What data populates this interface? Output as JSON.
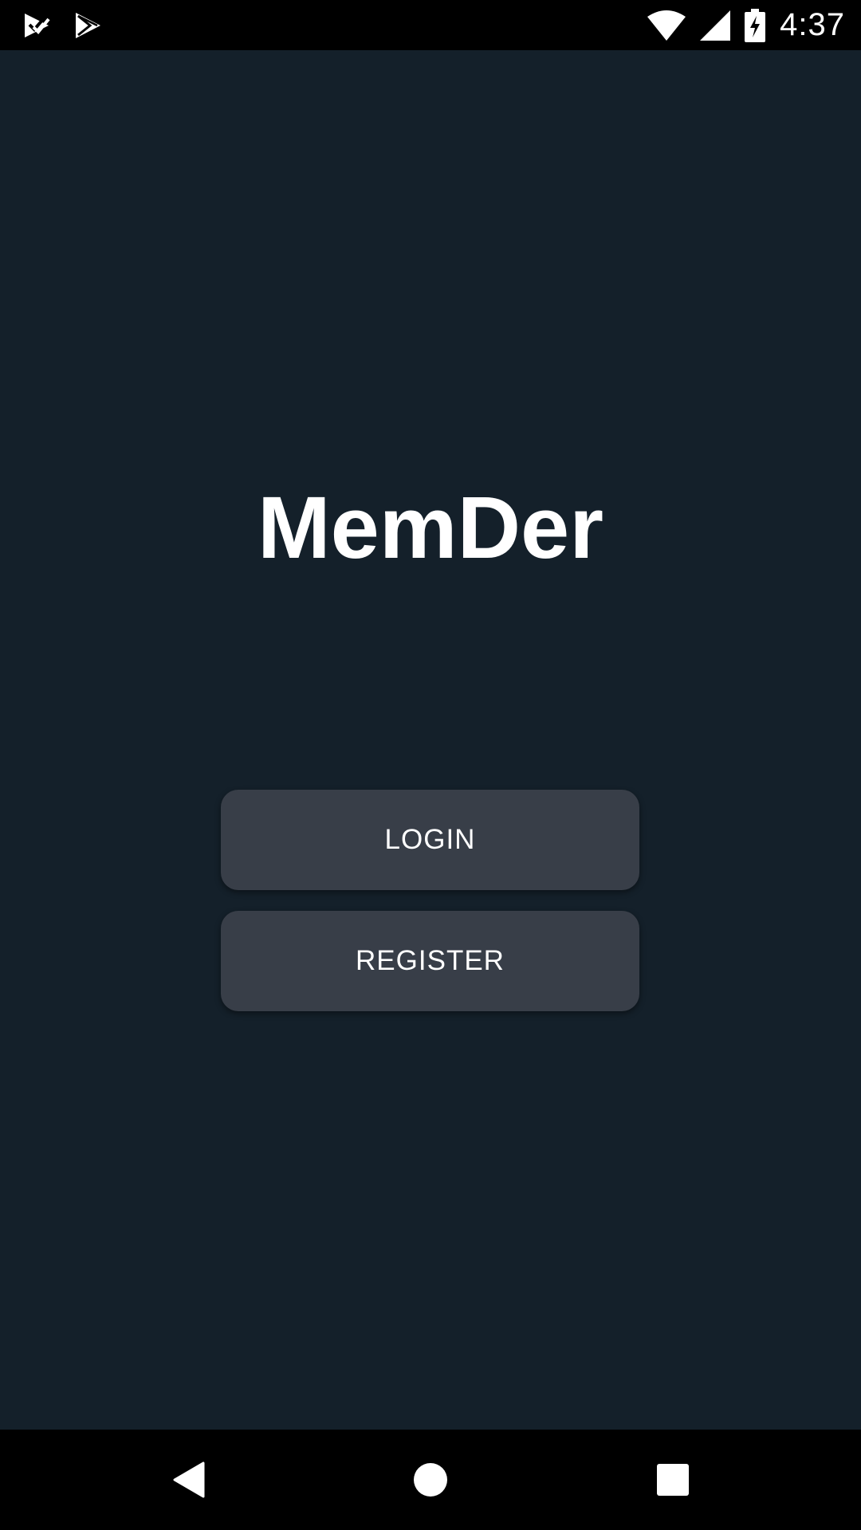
{
  "status_bar": {
    "time": "4:37",
    "left_icons": [
      "task-check-icon",
      "play-store-icon"
    ],
    "right_icons": [
      "wifi-icon",
      "cell-signal-icon",
      "battery-charging-icon"
    ]
  },
  "main": {
    "title": "MemDer",
    "login_label": "LOGIN",
    "register_label": "REGISTER"
  },
  "nav_bar": {
    "icons": [
      "back-icon",
      "home-icon",
      "recents-icon"
    ]
  },
  "colors": {
    "background": "#14202a",
    "button": "#383e48",
    "text": "#ffffff",
    "bars": "#000000"
  }
}
